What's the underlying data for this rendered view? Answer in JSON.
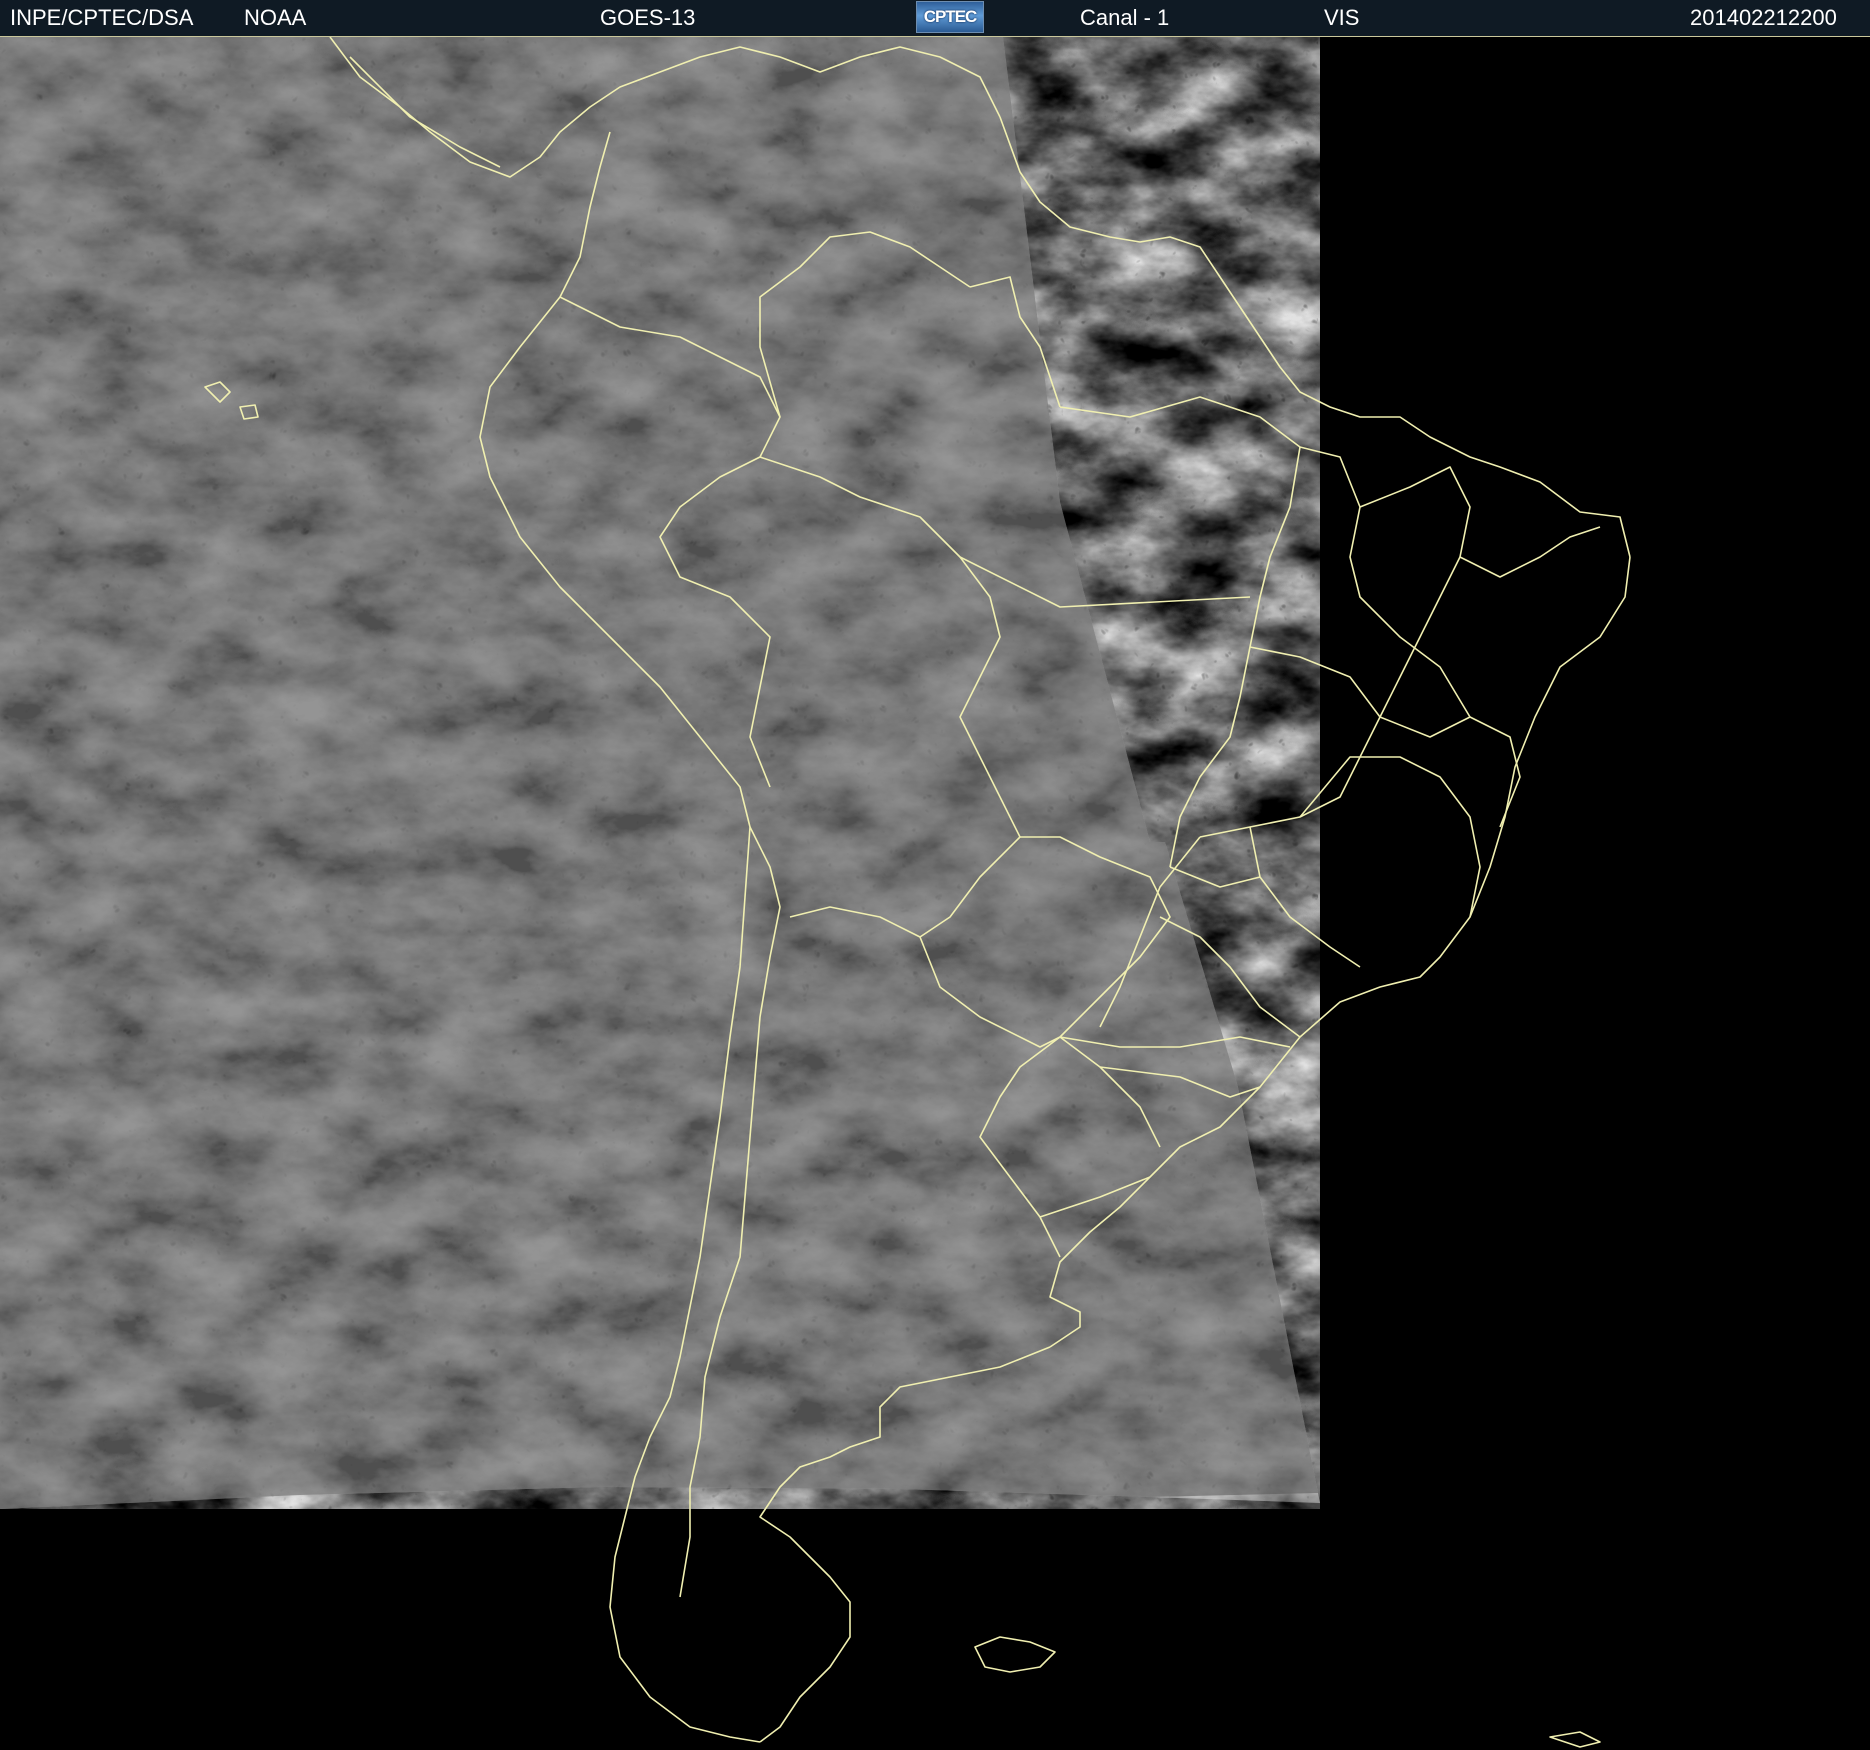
{
  "header": {
    "institution": "INPE/CPTEC/DSA",
    "agency": "NOAA",
    "satellite": "GOES-13",
    "logo_text": "CPTEC",
    "channel": "Canal - 1",
    "band": "VIS",
    "timestamp": "201402212200"
  },
  "colors": {
    "background": "#000000",
    "header_background": "#0f1a24",
    "border_lines": "#f0efb0",
    "cloud_base": "#3c3c3c",
    "cloud_bright": "#d8d8d8"
  },
  "map": {
    "type": "satellite visible imagery",
    "region": "South America",
    "overlay": "political boundaries (countries and Brazilian states)"
  }
}
